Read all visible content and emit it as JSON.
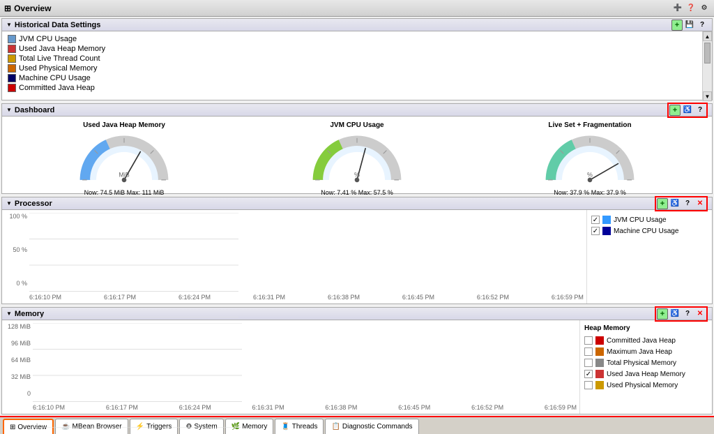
{
  "titleBar": {
    "title": "Overview",
    "icons": [
      "+",
      "?",
      "x"
    ]
  },
  "historicalPanel": {
    "title": "Historical Data Settings",
    "items": [
      {
        "label": "JVM CPU Usage",
        "color": "#6699cc"
      },
      {
        "label": "Used Java Heap Memory",
        "color": "#cc3333"
      },
      {
        "label": "Total Live Thread Count",
        "color": "#cc9900"
      },
      {
        "label": "Used Physical Memory",
        "color": "#cc6600"
      },
      {
        "label": "Machine CPU Usage",
        "color": "#000066"
      },
      {
        "label": "Committed Java Heap",
        "color": "#cc0000"
      }
    ]
  },
  "dashboardPanel": {
    "title": "Dashboard",
    "gauges": [
      {
        "label": "Used Java Heap Memory",
        "unit": "MiB",
        "now": "74.5 MiB",
        "max": "111 MiB",
        "valueText": "Now: 74.5 MiB  Max: 111 MiB",
        "needleAngle": -60,
        "color": "#3399ff"
      },
      {
        "label": "JVM CPU Usage",
        "unit": "%",
        "now": "7.41 %",
        "max": "57.5 %",
        "valueText": "Now: 7.41 %  Max: 57.5 %",
        "needleAngle": -75,
        "color": "#66cc00"
      },
      {
        "label": "Live Set + Fragmentation",
        "unit": "%",
        "now": "37.9 %",
        "max": "37.9 %",
        "valueText": "Now: 37.9 %  Max: 37.9 %",
        "needleAngle": -30,
        "color": "#33cc99"
      }
    ]
  },
  "processorPanel": {
    "title": "Processor",
    "yLabels": [
      "100 %",
      "50 %",
      "0 %"
    ],
    "xLabels": [
      "6:16:10 PM",
      "6:16:17 PM",
      "6:16:24 PM",
      "6:16:31 PM",
      "6:16:38 PM",
      "6:16:45 PM",
      "6:16:52 PM",
      "6:16:59 PM"
    ],
    "legend": [
      {
        "label": "JVM CPU Usage",
        "color": "#3399ff",
        "checked": true
      },
      {
        "label": "Machine CPU Usage",
        "color": "#000099",
        "checked": true
      }
    ]
  },
  "memoryPanel": {
    "title": "Memory",
    "yLabels": [
      "128 MiB",
      "96 MiB",
      "64 MiB",
      "32 MiB",
      "0"
    ],
    "xLabels": [
      "6:16:10 PM",
      "6:16:17 PM",
      "6:16:24 PM",
      "6:16:31 PM",
      "6:16:38 PM",
      "6:16:45 PM",
      "6:16:52 PM",
      "6:16:59 PM"
    ],
    "legend": [
      {
        "label": "Committed Java Heap",
        "color": "#cc0000",
        "checked": false
      },
      {
        "label": "Maximum Java Heap",
        "color": "#cc6600",
        "checked": false
      },
      {
        "label": "Total Physical Memory",
        "color": "#888888",
        "checked": false
      },
      {
        "label": "Used Java Heap Memory",
        "color": "#cc3333",
        "checked": true
      },
      {
        "label": "Used Physical Memory",
        "color": "#cc9900",
        "checked": false
      }
    ],
    "heapLabel": "Heap Memory"
  },
  "bottomTabs": {
    "tabs": [
      {
        "label": "Overview",
        "icon": "⊞",
        "active": true
      },
      {
        "label": "MBean Browser",
        "icon": "☕",
        "active": false
      },
      {
        "label": "Triggers",
        "icon": "⚡",
        "active": false
      },
      {
        "label": "System",
        "icon": "⚙",
        "active": false
      },
      {
        "label": "Memory",
        "icon": "🌿",
        "active": false
      },
      {
        "label": "Threads",
        "icon": "🧵",
        "active": false
      },
      {
        "label": "Diagnostic Commands",
        "icon": "📋",
        "active": false
      }
    ]
  }
}
